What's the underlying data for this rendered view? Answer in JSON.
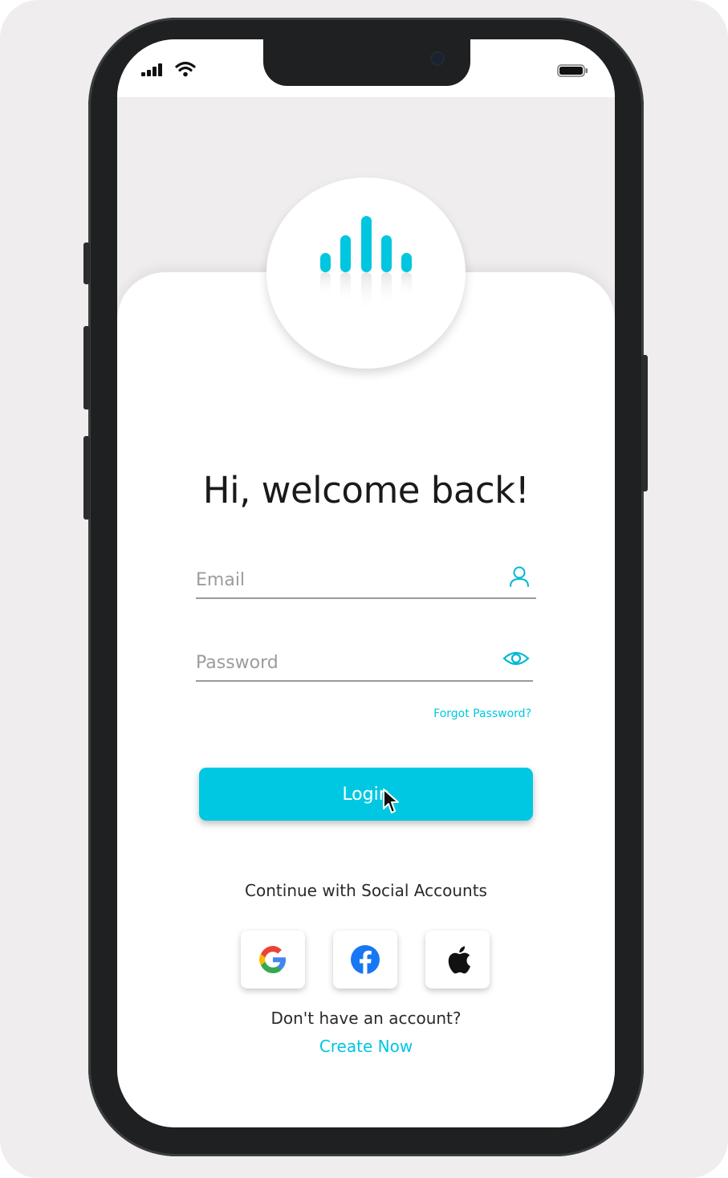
{
  "status_bar": {
    "icons": [
      "signal-icon",
      "wifi-icon",
      "battery-icon"
    ]
  },
  "login": {
    "heading": "Hi, welcome back!",
    "email_placeholder": "Email",
    "email_icon": "user-icon",
    "password_placeholder": "Password",
    "password_icon": "eye-icon",
    "forgot_password": "Forgot Password?",
    "login_button": "Login"
  },
  "social": {
    "title": "Continue with Social Accounts",
    "providers": [
      "google-icon",
      "facebook-icon",
      "apple-icon"
    ]
  },
  "signup": {
    "prompt": "Don't have an account?",
    "link": "Create Now"
  },
  "colors": {
    "accent": "#00c8e2",
    "background": "#efeded",
    "text": "#1a1a1a",
    "muted": "#9c9c9c"
  }
}
